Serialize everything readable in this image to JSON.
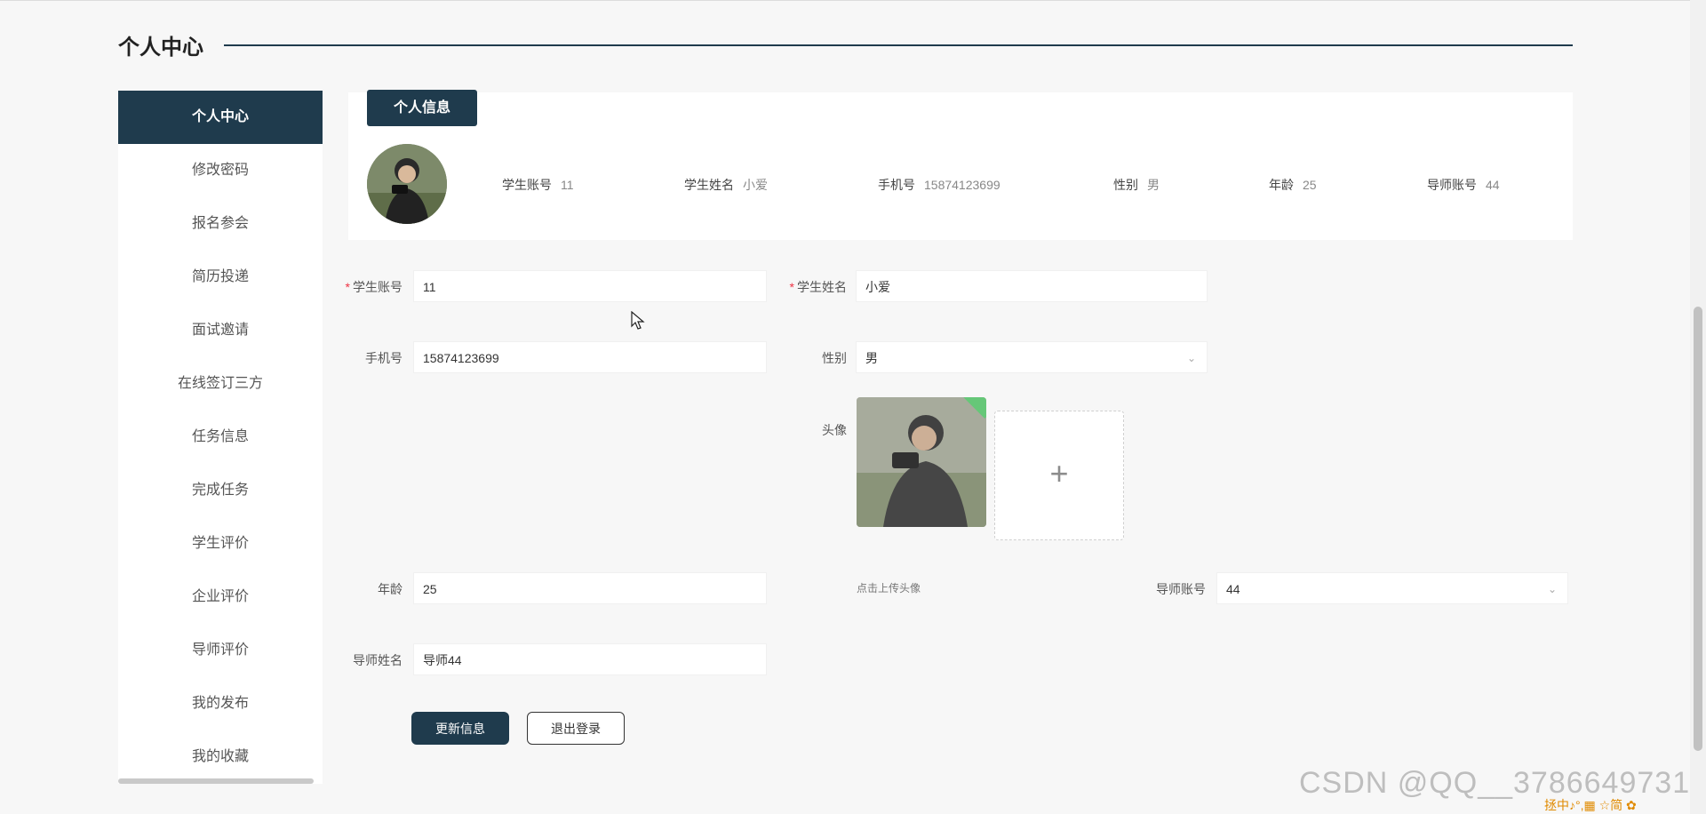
{
  "header": {
    "title": "个人中心"
  },
  "sidebar": {
    "items": [
      {
        "label": "个人中心",
        "active": true
      },
      {
        "label": "修改密码"
      },
      {
        "label": "报名参会"
      },
      {
        "label": "简历投递"
      },
      {
        "label": "面试邀请"
      },
      {
        "label": "在线签订三方"
      },
      {
        "label": "任务信息"
      },
      {
        "label": "完成任务"
      },
      {
        "label": "学生评价"
      },
      {
        "label": "企业评价"
      },
      {
        "label": "导师评价"
      },
      {
        "label": "我的发布"
      },
      {
        "label": "我的收藏"
      }
    ]
  },
  "info": {
    "tab_label": "个人信息",
    "fields": [
      {
        "label": "学生账号",
        "value": "11"
      },
      {
        "label": "学生姓名",
        "value": "小爱"
      },
      {
        "label": "手机号",
        "value": "15874123699"
      },
      {
        "label": "性别",
        "value": "男"
      },
      {
        "label": "年龄",
        "value": "25"
      },
      {
        "label": "导师账号",
        "value": "44"
      }
    ]
  },
  "form": {
    "student_account": {
      "label": "学生账号",
      "value": "11",
      "required": "*"
    },
    "student_name": {
      "label": "学生姓名",
      "value": "小爱",
      "required": "*"
    },
    "phone": {
      "label": "手机号",
      "value": "15874123699"
    },
    "gender": {
      "label": "性别",
      "value": "男"
    },
    "avatar": {
      "label": "头像",
      "hint": "点击上传头像",
      "add_symbol": "+"
    },
    "age": {
      "label": "年龄",
      "value": "25"
    },
    "mentor_account": {
      "label": "导师账号",
      "value": "44"
    },
    "mentor_name": {
      "label": "导师姓名",
      "value": "导师44"
    },
    "update_button": "更新信息",
    "logout_button": "退出登录"
  },
  "overlay": {
    "watermark": "CSDN @QQ__3786649731",
    "tray": "拯中♪°,▦ ☆简 ✿"
  },
  "colors": {
    "primary": "#1f3b4d",
    "required": "#ee3344",
    "upload_success": "#57c26b"
  }
}
